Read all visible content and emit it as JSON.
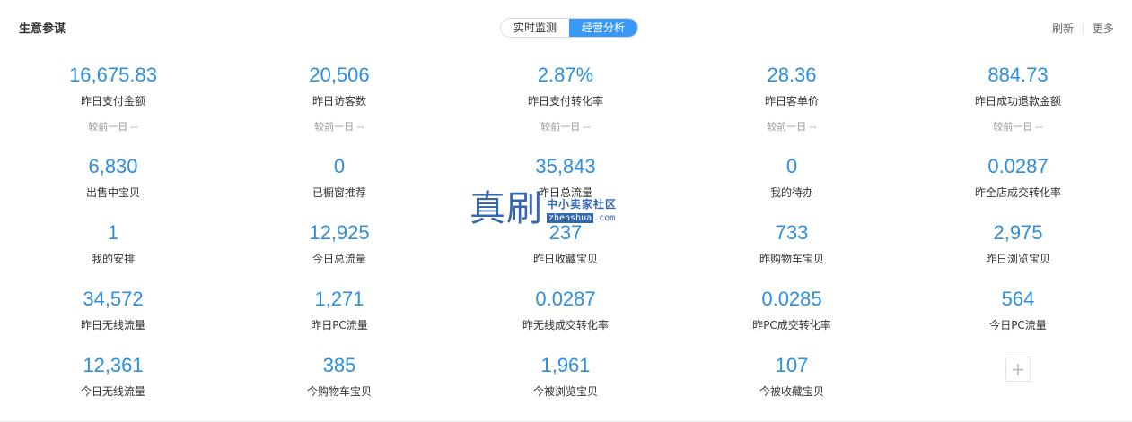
{
  "header": {
    "title": "生意参谋",
    "tabs": [
      {
        "label": "实时监测",
        "active": false
      },
      {
        "label": "经营分析",
        "active": true
      }
    ],
    "refresh_label": "刷新",
    "more_label": "更多"
  },
  "compare_text": "较前一日 --",
  "metrics": [
    [
      {
        "value": "16,675.83",
        "label": "昨日支付金额"
      },
      {
        "value": "20,506",
        "label": "昨日访客数"
      },
      {
        "value": "2.87%",
        "label": "昨日支付转化率"
      },
      {
        "value": "28.36",
        "label": "昨日客单价"
      },
      {
        "value": "884.73",
        "label": "昨日成功退款金额"
      }
    ],
    [
      {
        "value": "6,830",
        "label": "出售中宝贝"
      },
      {
        "value": "0",
        "label": "已橱窗推荐"
      },
      {
        "value": "35,843",
        "label": "昨日总流量"
      },
      {
        "value": "0",
        "label": "我的待办"
      },
      {
        "value": "0.0287",
        "label": "昨全店成交转化率"
      }
    ],
    [
      {
        "value": "1",
        "label": "我的安排"
      },
      {
        "value": "12,925",
        "label": "今日总流量"
      },
      {
        "value": "237",
        "label": "昨日收藏宝贝"
      },
      {
        "value": "733",
        "label": "昨购物车宝贝"
      },
      {
        "value": "2,975",
        "label": "昨日浏览宝贝"
      }
    ],
    [
      {
        "value": "34,572",
        "label": "昨日无线流量"
      },
      {
        "value": "1,271",
        "label": "昨日PC流量"
      },
      {
        "value": "0.0287",
        "label": "昨无线成交转化率"
      },
      {
        "value": "0.0285",
        "label": "昨PC成交转化率"
      },
      {
        "value": "564",
        "label": "今日PC流量"
      }
    ],
    [
      {
        "value": "12,361",
        "label": "今日无线流量"
      },
      {
        "value": "385",
        "label": "今购物车宝贝"
      },
      {
        "value": "1,961",
        "label": "今被浏览宝贝"
      },
      {
        "value": "107",
        "label": "今被收藏宝贝"
      }
    ]
  ],
  "add_button_icon": "plus-icon",
  "add_button_glyph": "+",
  "watermark": {
    "main": "真刷",
    "top": "中小卖家社区",
    "bottom_box": "zhenshua",
    "bottom_suffix": ".com"
  }
}
